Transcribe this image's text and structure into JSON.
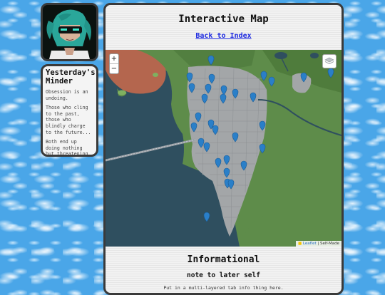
{
  "sidebar": {
    "title": "Yesterday's Minder",
    "paragraphs": [
      "Obsession is an undoing.",
      "Those who cling to the past, those who blindly charge to the future...",
      "Both end up doing nothing but threatening the present."
    ]
  },
  "main": {
    "title": "Interactive Map",
    "back_link": "Back to Index"
  },
  "map": {
    "zoom_in": "+",
    "zoom_out": "−",
    "attribution_flag": "■",
    "attribution_leaflet": "Leaflet",
    "attribution_sep": "|",
    "attribution_text": "Self-Made"
  },
  "info": {
    "title": "Informational",
    "note_title": "note to later self",
    "note_text": "Put in a multi-layered tab info thing here."
  },
  "colors": {
    "water": "#2f4f5f",
    "land": "#5e8c4a",
    "city": "#a3a6a8",
    "marker": "#2a7fc8",
    "link": "#1e2be0"
  }
}
